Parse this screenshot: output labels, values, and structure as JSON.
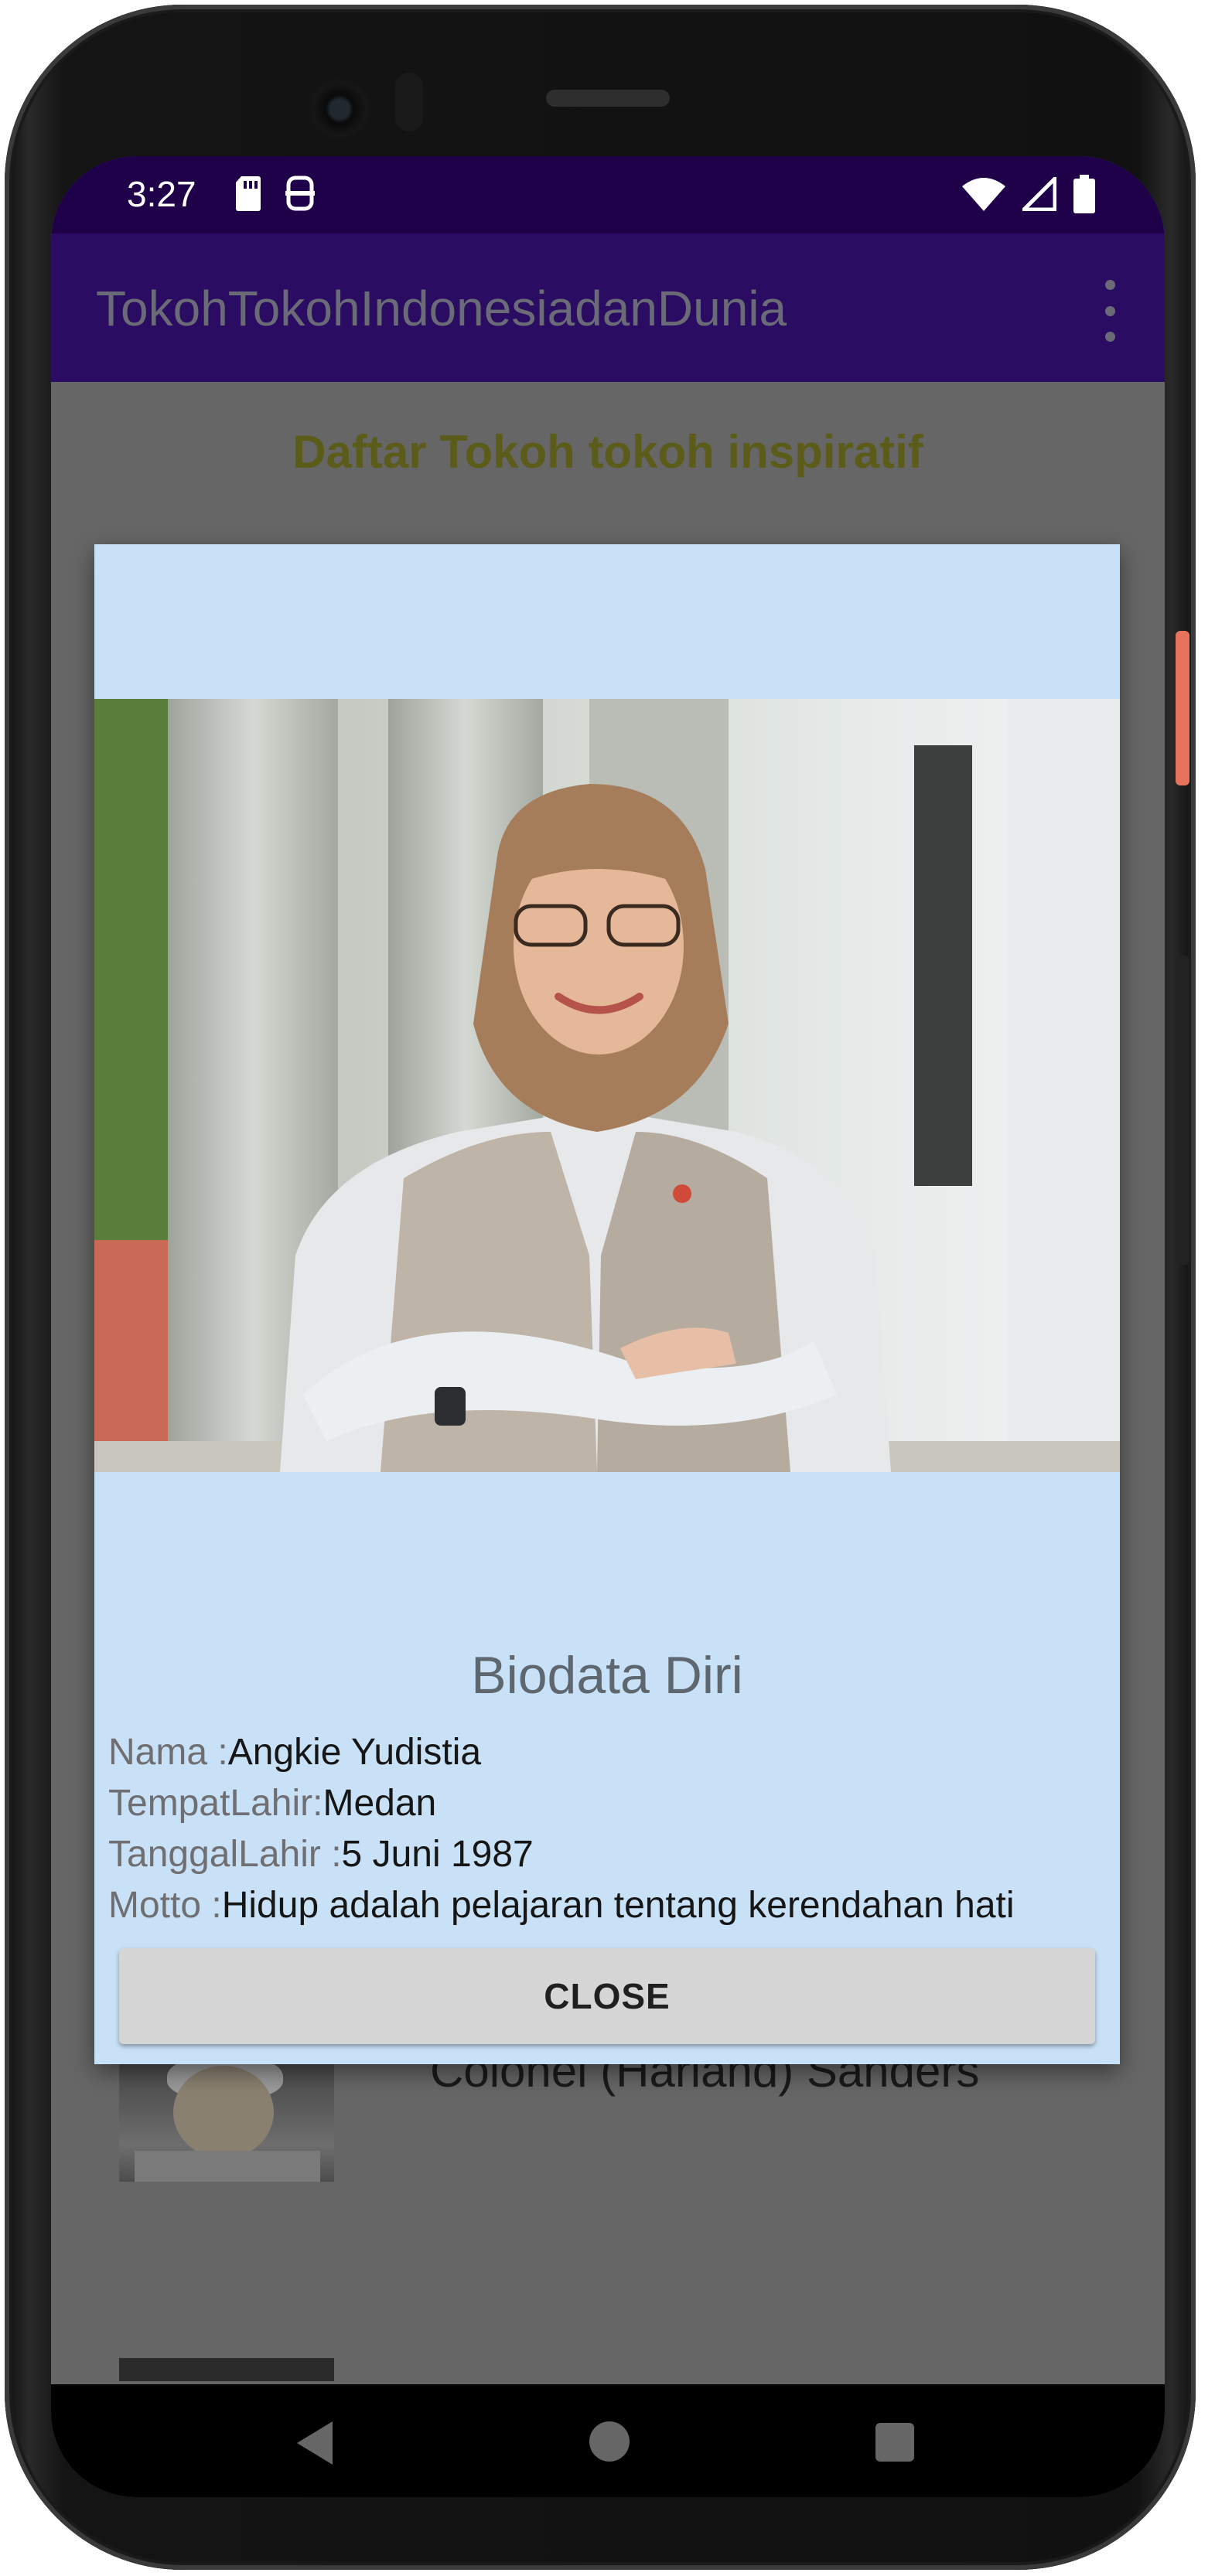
{
  "status_bar": {
    "time": "3:27",
    "icons_left": [
      "sd-card-icon",
      "vpn-icon"
    ],
    "icons_right": [
      "wifi-icon",
      "signal-icon",
      "battery-icon"
    ],
    "color": "#1e0149"
  },
  "app_bar": {
    "title": "TokohTokohIndonesiadanDunia",
    "color": "#2a0d62"
  },
  "list": {
    "heading": "Daftar Tokoh tokoh inspiratif",
    "items": [
      {
        "name": "Colonel (Harland) Sanders"
      }
    ]
  },
  "dialog": {
    "background": "#c8e1f6",
    "title": "Biodata Diri",
    "fields": [
      {
        "label": "Nama :",
        "value": "Angkie Yudistia"
      },
      {
        "label": "TempatLahir:",
        "value": "Medan"
      },
      {
        "label": "TanggalLahir :",
        "value": "5 Juni 1987"
      },
      {
        "label": "Motto :",
        "value": "Hidup adalah pelajaran tentang kerendahan hati"
      }
    ],
    "close_label": "CLOSE"
  },
  "nav_bar": {
    "icons": [
      "back-icon",
      "home-icon",
      "recents-icon"
    ]
  }
}
